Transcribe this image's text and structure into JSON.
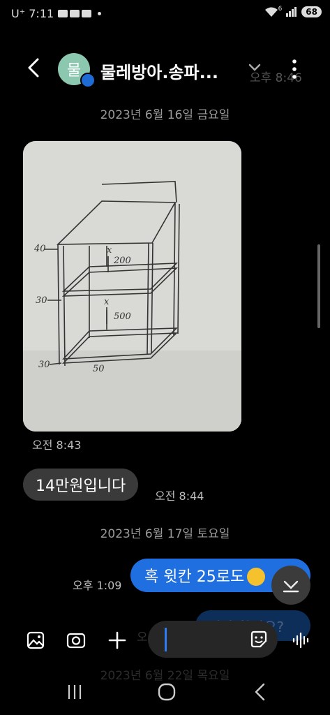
{
  "status_bar": {
    "carrier_time": "U⁺ 7:11",
    "wifi_badge": "6",
    "battery": "68"
  },
  "header": {
    "avatar_letter": "물",
    "title": "물레방아.송파...",
    "ghost_time": "오후 8:46"
  },
  "messages": {
    "date1": "2023년 6월 16일 금요일",
    "photo_time": "오전 8:43",
    "msg1_text": "14만원입니다",
    "msg1_time": "오전 8:44",
    "date2": "2023년 6월 17일 토요일",
    "msg2_text": "혹 윗칸 25로도",
    "msg2_time": "오후 1:09",
    "hidden_bubble_text": "되나 확인요?",
    "hidden_time": "오",
    "date3": "2023년 6월 22일 목요일"
  },
  "sketch": {
    "labels": [
      "40",
      "30",
      "30",
      "50",
      "200",
      "500",
      "x",
      "x"
    ]
  },
  "icons": {
    "back": "back-chevron-icon",
    "caret": "chevron-down-icon",
    "more": "more-vertical-icon",
    "gallery": "gallery-icon",
    "camera": "camera-icon",
    "plus": "plus-icon",
    "sticker": "sticker-icon",
    "voice": "voice-wave-icon",
    "scroll_down": "scroll-down-icon"
  }
}
